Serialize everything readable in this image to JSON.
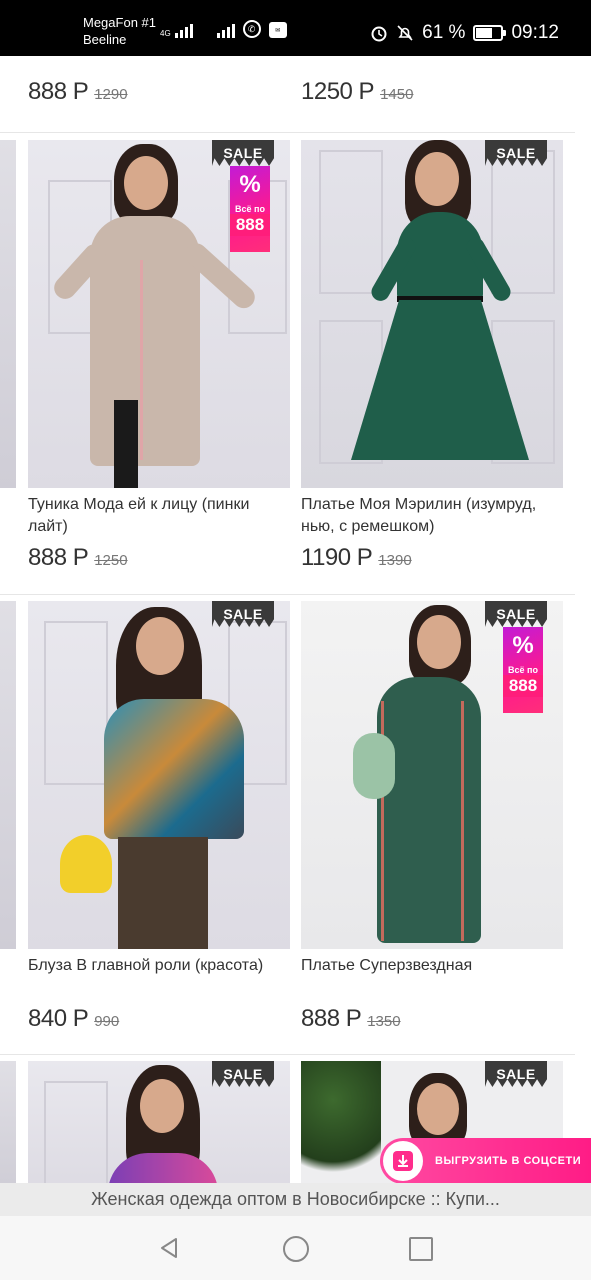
{
  "status": {
    "carrier1": "MegaFon #1",
    "carrier2": "Beeline",
    "net": "4G",
    "battery_pct": "61 %",
    "battery_level": 0.61,
    "time": "09:12"
  },
  "top_prices": [
    {
      "price": "888 Р",
      "old": "1290"
    },
    {
      "price": "1250 Р",
      "old": "1450"
    }
  ],
  "products": [
    {
      "title": "Туника Мода ей к лицу (пинки лайт)",
      "price": "888 Р",
      "old": "1250",
      "sale": "SALE",
      "promo": true
    },
    {
      "title": "Платье Моя Мэрилин (изумруд, нью, с ремешком)",
      "price": "1190 Р",
      "old": "1390",
      "sale": "SALE",
      "promo": false
    },
    {
      "title": "Блуза В главной роли (красота)",
      "price": "840 Р",
      "old": "990",
      "sale": "SALE",
      "promo": false
    },
    {
      "title": "Платье Суперзвездная",
      "price": "888 Р",
      "old": "1350",
      "sale": "SALE",
      "promo": true
    },
    {
      "title": "",
      "price": "",
      "old": "",
      "sale": "SALE",
      "promo": false
    },
    {
      "title": "",
      "price": "",
      "old": "",
      "sale": "SALE",
      "promo": false
    }
  ],
  "promo": {
    "pct": "%",
    "all": "Всё по",
    "num": "888"
  },
  "share": {
    "label": "ВЫГРУЗИТЬ В СОЦСЕТИ"
  },
  "page_title": "Женская одежда оптом в Новосибирске :: Купи...",
  "icons": [
    "signal-icon",
    "viber-icon",
    "alarm-icon",
    "mute-icon",
    "battery-icon",
    "download-icon",
    "back-icon",
    "home-icon",
    "recent-apps-icon"
  ],
  "colors": {
    "accent": "#ff1c86",
    "sale_badge": "#3a3a3a"
  }
}
